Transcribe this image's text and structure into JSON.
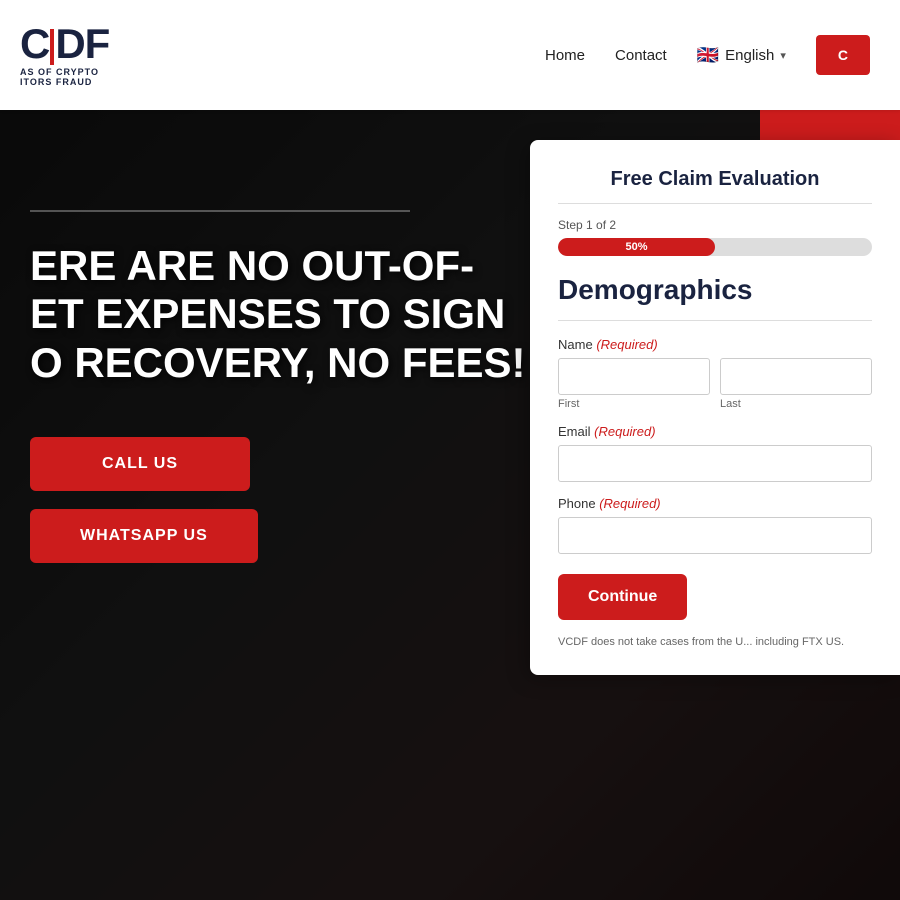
{
  "header": {
    "logo_letters": "CDF",
    "logo_subtitle_line1": "AS OF CRYPTO",
    "logo_subtitle_line2": "ITORS FRAUD",
    "nav": {
      "home_label": "Home",
      "contact_label": "Contact",
      "language_label": "English",
      "cta_label": "C"
    }
  },
  "hero": {
    "title_line1": "ERE ARE NO OUT-OF-",
    "title_line2": "ET EXPENSES TO SIGN",
    "title_line3": "O RECOVERY, NO FEES!",
    "call_btn": "CALL US",
    "whatsapp_btn": "WHATSAPP US"
  },
  "form": {
    "title": "Free Claim Evaluation",
    "step_label": "Step 1 of 2",
    "progress_pct": "50%",
    "progress_value": 50,
    "section_heading": "Demographics",
    "name_label": "Name",
    "name_required": "(Required)",
    "first_label": "First",
    "last_label": "Last",
    "email_label": "Email",
    "email_required": "(Required)",
    "phone_label": "Phone",
    "phone_required": "(Required)",
    "continue_btn": "Continue",
    "disclaimer": "VCDF does not take cases from the U... including FTX US."
  }
}
